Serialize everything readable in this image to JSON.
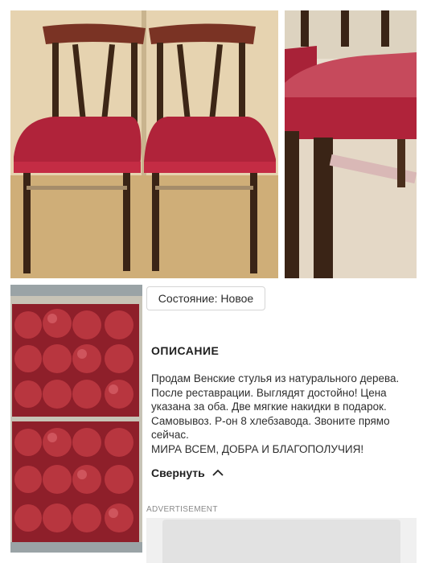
{
  "listing": {
    "condition_chip": "Состояние: Новое",
    "description_heading": "ОПИСАНИЕ",
    "description_text": "Продам Венские стулья из натурального дерева. После реставрации. Выглядят достойно! Цена указана за оба. Две мягкие накидки в подарок. Самовывоз. Р-он 8 хлебзавода. Звоните прямо сейчас.\nМИРА ВСЕМ, ДОБРА И БЛАГОПОЛУЧИЯ!",
    "collapse_label": "Свернуть",
    "ad_label": "ADVERTISEMENT"
  },
  "icons": {
    "collapse": "chevron-up-icon"
  },
  "colors": {
    "upholstery_red": "#b0233a",
    "wood_dark": "#3a2416",
    "text": "#2e2e2e"
  }
}
